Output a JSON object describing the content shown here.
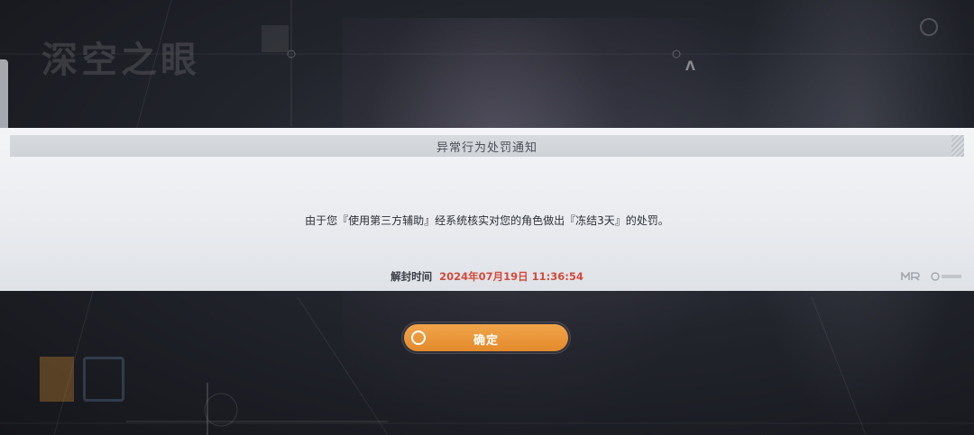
{
  "background": {
    "logo_text": "深空之眼"
  },
  "dialog": {
    "title": "异常行为处罚通知",
    "message": "由于您『使用第三方辅助』经系统核实对您的角色做出『冻结3天』的处罚。",
    "unlock_label": "解封时间",
    "unlock_time": "2024年07月19日 11:36:54"
  },
  "confirm_button": {
    "label": "确定"
  },
  "colors": {
    "accent": "#e8952f",
    "unlock_time_color": "#d24a3c"
  },
  "icons": {
    "button_ring": "circle-icon",
    "corner_logo_1": "mr-logo-icon",
    "corner_logo_2": "publisher-logo-icon"
  }
}
